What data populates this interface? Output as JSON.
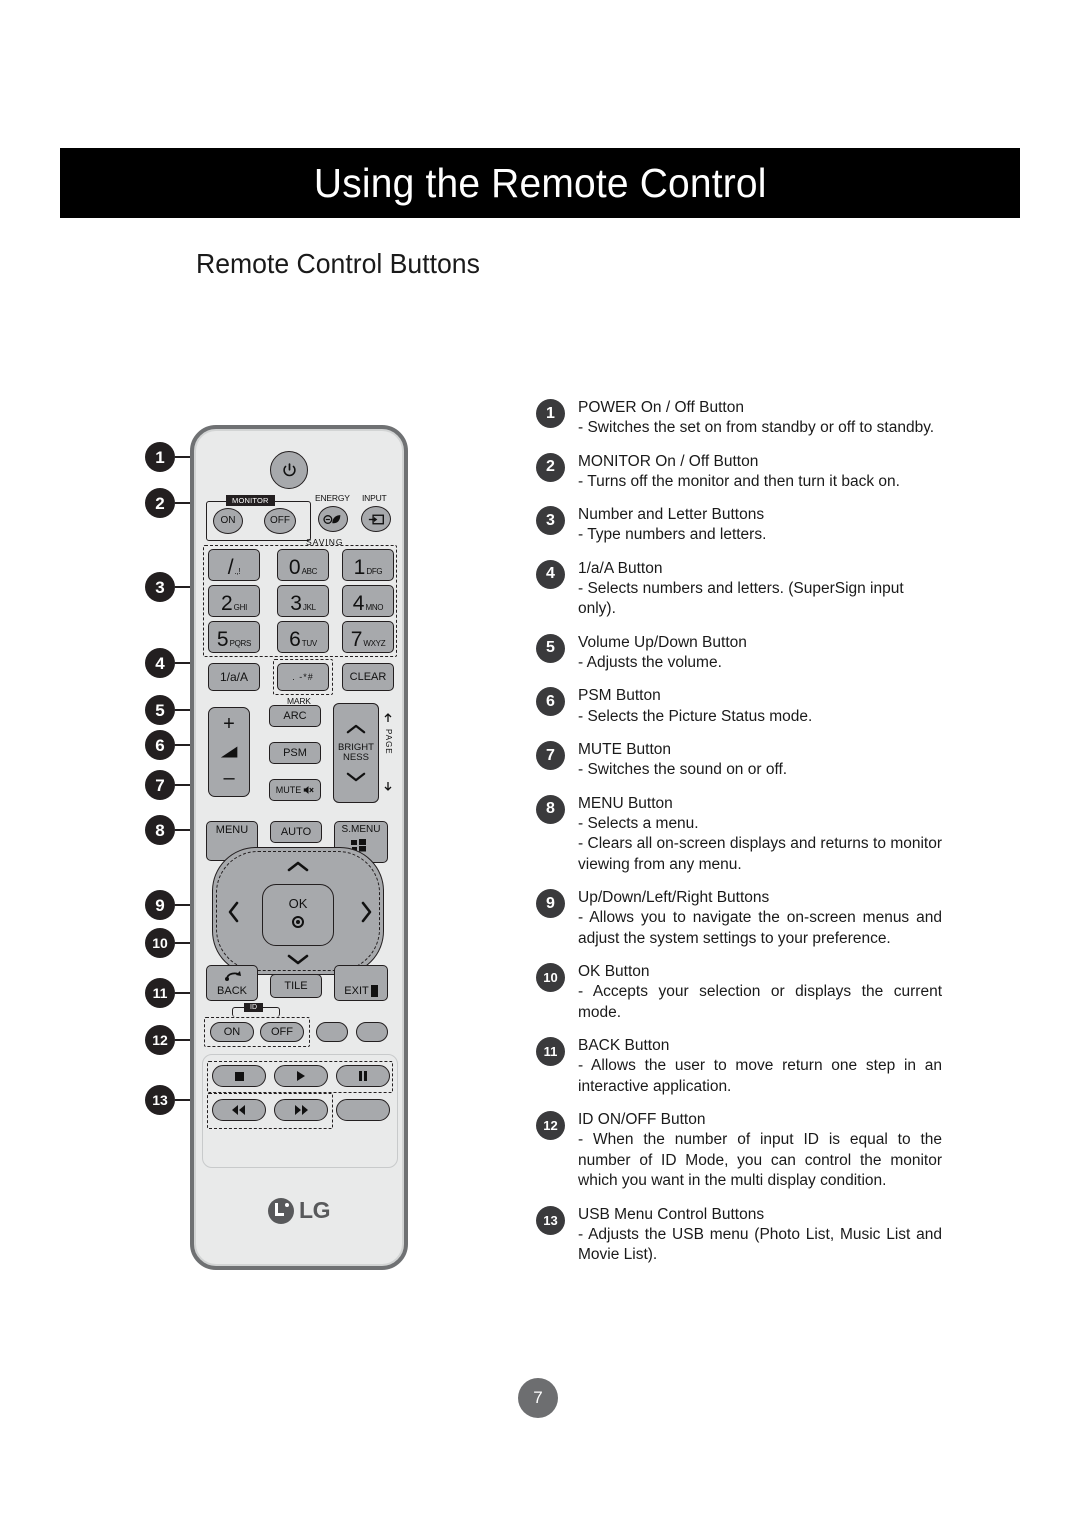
{
  "header": {
    "title": "Using the Remote Control",
    "section_title": "Remote Control Buttons"
  },
  "footer": {
    "page_number": "7"
  },
  "colors": {
    "header_bg": "#000000",
    "header_text": "#ffffff",
    "badge_bg": "#3a3a3c",
    "callout_bg": "#231f20",
    "remote_body": "#e9eaea",
    "remote_frame": "#6f7173",
    "button_face": "#a7a9ac",
    "page_badge": "#6d6e70",
    "lg_logo": "#58595b"
  },
  "remote": {
    "brand": "LG",
    "power_button": "power-icon",
    "monitor_group_label": "MONITOR",
    "monitor_on": "ON",
    "monitor_off": "OFF",
    "energy_label": "ENERGY",
    "saving_label": "SAVING",
    "energy_icon": "eco-leaf-icon",
    "input_label": "INPUT",
    "input_icon": "input-source-icon",
    "keypad": [
      {
        "big": "/",
        "sub": ".,!"
      },
      {
        "big": "0",
        "sub": "ABC"
      },
      {
        "big": "1",
        "sub": "DFG"
      },
      {
        "big": "2",
        "sub": "GHI"
      },
      {
        "big": "3",
        "sub": "JKL"
      },
      {
        "big": "4",
        "sub": "MNO"
      },
      {
        "big": "5",
        "sub": "PQRS"
      },
      {
        "big": "6",
        "sub": "TUV"
      },
      {
        "big": "7",
        "sub": "WXYZ"
      }
    ],
    "alpha_button": "1/a/A",
    "symbol_button": ".  -*#",
    "clear_button": "CLEAR",
    "mark_label": "MARK",
    "arc_button": "ARC",
    "psm_button": "PSM",
    "mute_button": "MUTE",
    "mute_icon": "mute-speaker-icon",
    "volume_plus": "+",
    "volume_minus": "–",
    "volume_icon": "volume-wedge-icon",
    "brightness_label_1": "BRIGHT",
    "brightness_label_2": "NESS",
    "brightness_up_icon": "chevron-up-icon",
    "brightness_down_icon": "chevron-down-icon",
    "page_label": "PAGE",
    "menu_button": "MENU",
    "auto_button": "AUTO",
    "smenu_button": "S.MENU",
    "nav_up_icon": "chevron-up-icon",
    "nav_down_icon": "chevron-down-icon",
    "nav_left_icon": "chevron-left-icon",
    "nav_right_icon": "chevron-right-icon",
    "ok_button": "OK",
    "back_button": "BACK",
    "back_icon": "back-arrow-icon",
    "tile_button": "TILE",
    "exit_button": "EXIT",
    "id_label": "ID",
    "id_on": "ON",
    "id_off": "OFF",
    "usb_stop_icon": "stop-icon",
    "usb_play_icon": "play-icon",
    "usb_pause_icon": "pause-icon",
    "usb_rewind_icon": "rewind-icon",
    "usb_forward_icon": "fast-forward-icon"
  },
  "callouts": [
    {
      "num": "1"
    },
    {
      "num": "2"
    },
    {
      "num": "3"
    },
    {
      "num": "4"
    },
    {
      "num": "5"
    },
    {
      "num": "6"
    },
    {
      "num": "7"
    },
    {
      "num": "8"
    },
    {
      "num": "9"
    },
    {
      "num": "10"
    },
    {
      "num": "11"
    },
    {
      "num": "12"
    },
    {
      "num": "13"
    }
  ],
  "descriptions": [
    {
      "num": "1",
      "heading": "POWER On / Off Button",
      "body": "- Switches the set on from standby or off to standby."
    },
    {
      "num": "2",
      "heading": "MONITOR On / Off Button",
      "body": "- Turns off the monitor and then turn it back on."
    },
    {
      "num": "3",
      "heading": "Number and Letter Buttons",
      "body": "- Type numbers and letters."
    },
    {
      "num": "4",
      "heading": "1/a/A Button",
      "body": "- Selects numbers and letters. (SuperSign input only)."
    },
    {
      "num": "5",
      "heading": "Volume Up/Down Button",
      "body": "- Adjusts the volume."
    },
    {
      "num": "6",
      "heading": "PSM Button",
      "body": "- Selects the Picture Status mode."
    },
    {
      "num": "7",
      "heading": "MUTE Button",
      "body": "- Switches the sound on or off."
    },
    {
      "num": "8",
      "heading": "MENU Button",
      "body": "- Selects a menu.",
      "body2": "- Clears all on-screen displays and returns to monitor viewing from any menu."
    },
    {
      "num": "9",
      "heading": "Up/Down/Left/Right Buttons",
      "body": "- Allows you to navigate the on-screen menus and adjust the system settings to your preference."
    },
    {
      "num": "10",
      "heading": " OK Button",
      "body": "- Accepts your selection or displays the current mode."
    },
    {
      "num": "11",
      "heading": "BACK Button",
      "body": "- Allows the user to move return one step in an interactive application."
    },
    {
      "num": "12",
      "heading": "ID ON/OFF Button",
      "body": "- When the number of input ID is equal to the number of ID Mode, you can control the monitor which you want in the multi display condition."
    },
    {
      "num": "13",
      "heading": "USB Menu Control Buttons",
      "body": "- Adjusts the USB menu (Photo List, Music List and Movie List)."
    }
  ]
}
